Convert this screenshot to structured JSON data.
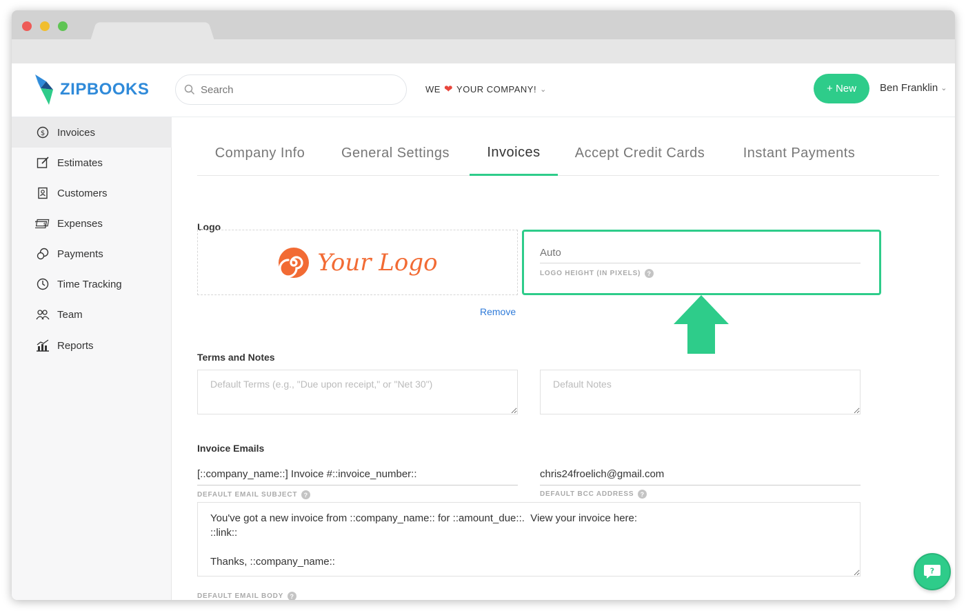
{
  "header": {
    "brand": "ZIPBOOKS",
    "search_placeholder": "Search",
    "company_before": "WE",
    "company_after": "YOUR COMPANY!",
    "new_button": "+ New",
    "user_name": "Ben Franklin"
  },
  "sidebar": {
    "items": [
      {
        "label": "Invoices",
        "icon": "dollar-circle-icon",
        "active": true
      },
      {
        "label": "Estimates",
        "icon": "edit-icon"
      },
      {
        "label": "Customers",
        "icon": "contact-book-icon"
      },
      {
        "label": "Expenses",
        "icon": "money-stack-icon"
      },
      {
        "label": "Payments",
        "icon": "coins-icon"
      },
      {
        "label": "Time Tracking",
        "icon": "clock-icon"
      },
      {
        "label": "Team",
        "icon": "people-icon"
      },
      {
        "label": "Reports",
        "icon": "bar-chart-icon"
      }
    ]
  },
  "tabs": [
    "Company Info",
    "General Settings",
    "Invoices",
    "Accept Credit Cards",
    "Instant Payments"
  ],
  "active_tab": "Invoices",
  "logo_section": {
    "label": "Logo",
    "logo_text": "Your Logo",
    "remove": "Remove",
    "height_placeholder": "Auto",
    "height_label": "LOGO HEIGHT (IN PIXELS)"
  },
  "terms_section": {
    "label": "Terms and Notes",
    "terms_placeholder": "Default Terms (e.g., \"Due upon receipt,\" or \"Net 30\")",
    "notes_placeholder": "Default Notes"
  },
  "emails_section": {
    "label": "Invoice Emails",
    "subject_value": "[::company_name::] Invoice #::invoice_number::",
    "subject_label": "DEFAULT EMAIL SUBJECT",
    "bcc_value": "chris24froelich@gmail.com",
    "bcc_label": "DEFAULT BCC ADDRESS",
    "body_value": "You've got a new invoice from ::company_name:: for ::amount_due::.  View your invoice here:\n::link::\n\nThanks, ::company_name::",
    "body_label": "DEFAULT EMAIL BODY"
  },
  "colors": {
    "accent": "#2ecc8a",
    "brand": "#2f8ad9",
    "logo_orange": "#f26b34"
  }
}
